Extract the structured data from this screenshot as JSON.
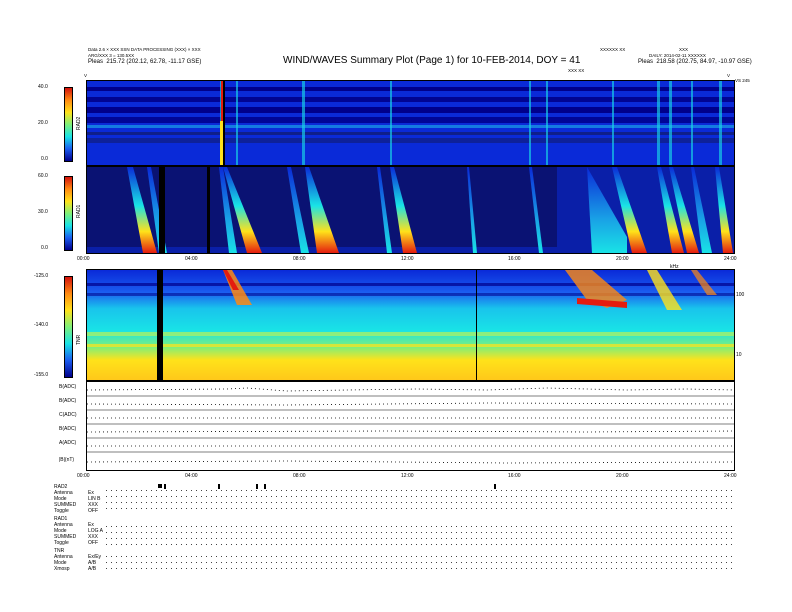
{
  "header": {
    "title": "WIND/WAVES Summary Plot (Page 1) for 10-FEB-2014, DOY = 41",
    "left_line1": "Data 2.6 × XXX SSN DATA PROCESSING (XXX) × XXX",
    "left_line2": "ARG/XXX 3 = 130.5XX",
    "left_line3": "Pleas",
    "left_orbit": "215.72 (202.12, 62.78, -11.17 GSE)",
    "center_small": "XXX XX",
    "right_line1": "XXXXXX XX",
    "right_line2": "DAILY: 2014-02-11 XXXXXX",
    "right_line3": "Pleas",
    "right_orbit": "218.58 (202.75, 84.97, -10.97 GSE)",
    "right_mini": "XXX",
    "top_tick_left": "V",
    "top_tick_right": "V",
    "vs_label": "VS 245"
  },
  "rad2": {
    "label": "RAD2",
    "scale_ticks": [
      "40.0",
      "20.0",
      "0.0"
    ]
  },
  "rad1": {
    "label": "RAD1",
    "scale_ticks": [
      "60.0",
      "30.0",
      "0.0"
    ]
  },
  "tnr": {
    "label": "TNR",
    "scale_ticks": [
      "-125.0",
      "-140.0",
      "-155.0"
    ],
    "right_ticks": [
      "100",
      "10"
    ],
    "right_unit": "kHz"
  },
  "time_axis": [
    "00:00",
    "04:00",
    "08:00",
    "12:00",
    "16:00",
    "20:00",
    "24:00"
  ],
  "line_panels": [
    {
      "label": "B(ADC)"
    },
    {
      "label": "B(ADC)"
    },
    {
      "label": "C(ADC)"
    },
    {
      "label": "B(ADC)"
    },
    {
      "label": "A(ADC)"
    },
    {
      "label": "|B|(nT)"
    }
  ],
  "status": {
    "rad2_header": "RAD2",
    "rad2_rows": [
      {
        "k": "Antenna",
        "v": "Ex"
      },
      {
        "k": "Mode",
        "v": "LIN B"
      },
      {
        "k": "SUMMED",
        "v": "XXX"
      },
      {
        "k": "Toggle",
        "v": "OFF"
      }
    ],
    "rad1_header": "RAD1",
    "rad1_rows": [
      {
        "k": "Antenna",
        "v": "Ex"
      },
      {
        "k": "Mode",
        "v": "LOG A"
      },
      {
        "k": "SUMMED",
        "v": "XXX"
      },
      {
        "k": "Toggle",
        "v": "OFF"
      }
    ],
    "tnr_header": "TNR",
    "tnr_rows": [
      {
        "k": "Antenna",
        "v": "Ex/Ey"
      },
      {
        "k": "Mode",
        "v": "A/B"
      },
      {
        "k": "Xmosp",
        "v": "A/B"
      }
    ]
  },
  "colors": {
    "bg": "#ffffff",
    "spec_dark": "#00008b",
    "spec_blue": "#0a2ad8",
    "spec_cyan": "#19e3e6",
    "spec_green": "#7ef07a",
    "spec_yellow": "#ffe21a",
    "spec_red": "#e41c0f"
  },
  "chart_data": [
    {
      "type": "heatmap",
      "title": "RAD2",
      "xlabel": "",
      "ylabel": "RAD2",
      "xlim": [
        "00:00",
        "24:00"
      ],
      "zlim": [
        0.0,
        40.0
      ]
    },
    {
      "type": "heatmap",
      "title": "RAD1",
      "xlabel": "",
      "ylabel": "RAD1",
      "xlim": [
        "00:00",
        "24:00"
      ],
      "zlim": [
        0.0,
        60.0
      ]
    },
    {
      "type": "heatmap",
      "title": "TNR",
      "xlabel": "",
      "ylabel": "TNR",
      "xlim": [
        "00:00",
        "24:00"
      ],
      "zlim": [
        -155.0,
        -125.0
      ]
    }
  ]
}
